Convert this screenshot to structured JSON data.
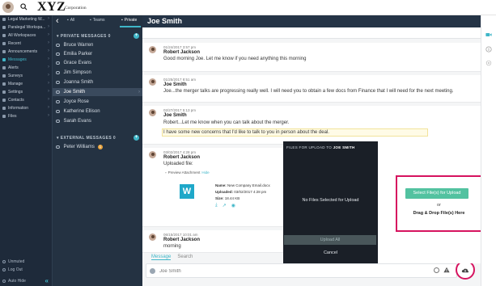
{
  "app": {
    "logo": "XYZ",
    "logo_sub": "Corporation"
  },
  "nav": {
    "items": [
      {
        "label": "Legal Marketing W...",
        "icon": "building-icon"
      },
      {
        "label": "Paralegal Workspa...",
        "icon": "building-icon"
      },
      {
        "label": "All Workspaces",
        "icon": "grid-icon"
      },
      {
        "label": "Recent",
        "icon": "clock-icon"
      },
      {
        "label": "Announcements",
        "icon": "megaphone-icon"
      },
      {
        "label": "Messages",
        "icon": "chat-icon",
        "active": true
      },
      {
        "label": "Alerts",
        "icon": "bell-icon"
      },
      {
        "label": "Surveys",
        "icon": "clipboard-icon"
      },
      {
        "label": "Manage",
        "icon": "wrench-icon"
      },
      {
        "label": "Settings",
        "icon": "gear-icon"
      },
      {
        "label": "Contacts",
        "icon": "person-icon"
      },
      {
        "label": "Information",
        "icon": "info-icon"
      },
      {
        "label": "Files",
        "icon": "folder-icon"
      }
    ],
    "bottom": [
      {
        "label": "Unmuted",
        "icon": "speaker-icon"
      },
      {
        "label": "Log Out",
        "icon": "logout-icon"
      },
      {
        "label": "Auto Hide",
        "icon": "toggle-icon"
      }
    ]
  },
  "conversations": {
    "tabs": [
      {
        "label": "All",
        "icon": "chat-icon"
      },
      {
        "label": "Teams",
        "icon": "group-icon"
      },
      {
        "label": "Private",
        "icon": "person-icon",
        "active": true
      }
    ],
    "private_title": "PRIVATE MESSAGES",
    "private_count": "0",
    "private": [
      "Bruce Warren",
      "Emilia Parker",
      "Grace Evans",
      "Jim Simpson",
      "Joanna Smith",
      "Joe Smith",
      "Joyce Rose",
      "Katherine Ellison",
      "Sarah Evans"
    ],
    "selected": "Joe Smith",
    "external_title": "EXTERNAL MESSAGES",
    "external_count": "0",
    "external": [
      {
        "name": "Peter Williams",
        "badge": "1"
      }
    ]
  },
  "chat": {
    "title": "Joe Smith",
    "messages": [
      {
        "time": "01/24/2017 3:57 pm",
        "name": "Robert Jackson",
        "lines": [
          "Good morning Joe.  Let me know if you need anything this morning"
        ]
      },
      {
        "time": "01/25/2017 8:51 am",
        "name": "Joe Smith",
        "lines": [
          "Joe...the merger talks are progressing really well. I will need you to obtain a few docs from Finance that I will need for the next meeting."
        ]
      },
      {
        "time": "02/27/2017 5:13 pm",
        "name": "Joe Smith",
        "lines": [
          "Robert...Let me know when you can talk about the merger.",
          "I have some new concerns that I'd like to talk to you in person about the deal."
        ]
      },
      {
        "time": "03/02/2017 4:28 pm",
        "name": "Robert Jackson",
        "lines": [
          "Uploaded file:"
        ]
      },
      {
        "time": "06/15/2017 10:01 am",
        "name": "Robert Jackson",
        "lines": [
          "morning"
        ]
      }
    ],
    "attachment": {
      "preview_label": "Preview Attachment",
      "hide_label": "Hide",
      "tile_letter": "W",
      "name_label": "Name:",
      "name_value": "New Company Email.docx",
      "uploaded_label": "Uploaded:",
      "uploaded_value": "03/02/2017 4:28 pm",
      "size_label": "Size:",
      "size_value": "18.44 KB"
    },
    "composer": {
      "tab_message": "Message",
      "tab_search": "Search",
      "placeholder": "Joe Smith"
    }
  },
  "upload": {
    "title_prefix": "FILES FOR UPLOAD TO",
    "title_name": "JOE SMITH",
    "empty_text": "No Files Selected for Upload",
    "upload_all": "Upload All",
    "cancel": "Cancel",
    "select_button": "Select File(s) for Upload",
    "or_text": "or",
    "drag_text": "Drag & Drop File(s) Here"
  },
  "colors": {
    "accent": "#3fb6c8",
    "highlight_frame": "#d6135f",
    "select_button": "#52c2a0",
    "nav_bg": "#1e2a3a"
  }
}
